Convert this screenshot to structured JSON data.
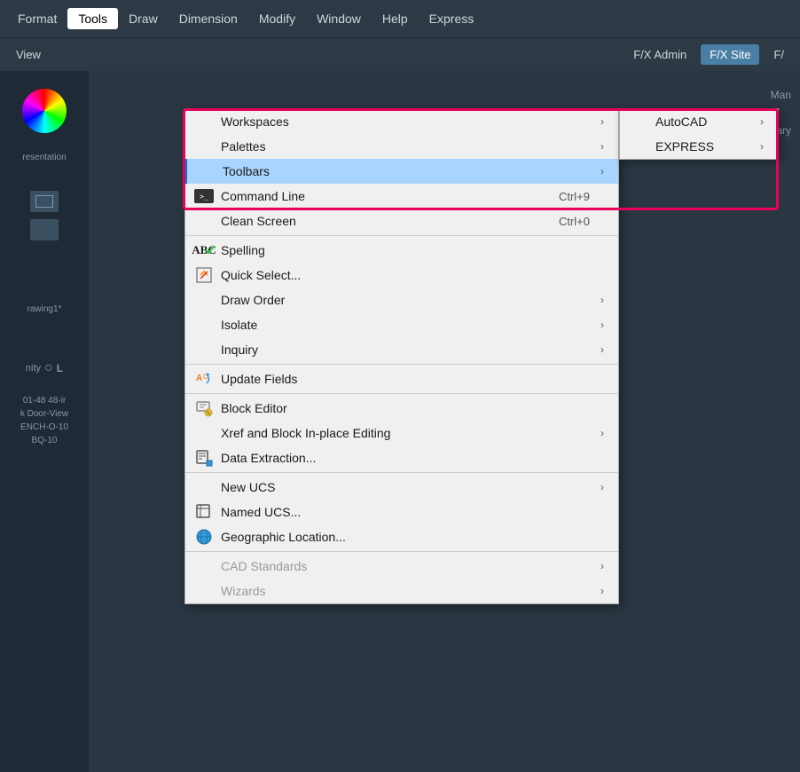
{
  "menubar": {
    "items": [
      {
        "label": "Format",
        "active": false
      },
      {
        "label": "Tools",
        "active": true
      },
      {
        "label": "Draw",
        "active": false
      },
      {
        "label": "Dimension",
        "active": false
      },
      {
        "label": "Modify",
        "active": false
      },
      {
        "label": "Window",
        "active": false
      },
      {
        "label": "Help",
        "active": false
      },
      {
        "label": "Express",
        "active": false
      }
    ]
  },
  "toolbar_tabs": [
    {
      "label": "View",
      "active": false
    },
    {
      "label": "F/X Admin",
      "active": false
    },
    {
      "label": "F/X Site",
      "active": true
    },
    {
      "label": "F/",
      "active": false
    }
  ],
  "tools_menu": {
    "items": [
      {
        "id": "workspaces",
        "label": "Workspaces",
        "shortcut": "",
        "hasArrow": true,
        "icon": ""
      },
      {
        "id": "palettes",
        "label": "Palettes",
        "shortcut": "",
        "hasArrow": true,
        "icon": ""
      },
      {
        "id": "toolbars",
        "label": "Toolbars",
        "shortcut": "",
        "hasArrow": true,
        "icon": "",
        "highlighted": true
      },
      {
        "id": "command-line",
        "label": "Command Line",
        "shortcut": "Ctrl+9",
        "hasArrow": false,
        "icon": "terminal"
      },
      {
        "id": "clean-screen",
        "label": "Clean Screen",
        "shortcut": "Ctrl+0",
        "hasArrow": false,
        "icon": ""
      },
      {
        "id": "spelling",
        "label": "Spelling",
        "shortcut": "",
        "hasArrow": false,
        "icon": "spelling"
      },
      {
        "id": "quick-select",
        "label": "Quick Select...",
        "shortcut": "",
        "hasArrow": false,
        "icon": "quickselect"
      },
      {
        "id": "draw-order",
        "label": "Draw Order",
        "shortcut": "",
        "hasArrow": true,
        "icon": ""
      },
      {
        "id": "isolate",
        "label": "Isolate",
        "shortcut": "",
        "hasArrow": true,
        "icon": ""
      },
      {
        "id": "inquiry",
        "label": "Inquiry",
        "shortcut": "",
        "hasArrow": true,
        "icon": ""
      },
      {
        "id": "update-fields",
        "label": "Update Fields",
        "shortcut": "",
        "hasArrow": false,
        "icon": "update-fields"
      },
      {
        "id": "block-editor",
        "label": "Block Editor",
        "shortcut": "",
        "hasArrow": false,
        "icon": "block-editor"
      },
      {
        "id": "xref-editing",
        "label": "Xref and Block In-place Editing",
        "shortcut": "",
        "hasArrow": true,
        "icon": ""
      },
      {
        "id": "data-extraction",
        "label": "Data Extraction...",
        "shortcut": "",
        "hasArrow": false,
        "icon": "data-extraction"
      },
      {
        "id": "new-ucs",
        "label": "New UCS",
        "shortcut": "",
        "hasArrow": true,
        "icon": ""
      },
      {
        "id": "named-ucs",
        "label": "Named UCS...",
        "shortcut": "",
        "hasArrow": false,
        "icon": "named-ucs"
      },
      {
        "id": "geographic-location",
        "label": "Geographic Location...",
        "shortcut": "",
        "hasArrow": false,
        "icon": "globe"
      },
      {
        "id": "cad-standards",
        "label": "CAD Standards",
        "shortcut": "",
        "hasArrow": true,
        "icon": "",
        "disabled": true
      },
      {
        "id": "wizards",
        "label": "Wizards",
        "shortcut": "",
        "hasArrow": true,
        "icon": "",
        "disabled": true
      }
    ]
  },
  "toolbars_submenu": {
    "items": [
      {
        "label": "AutoCAD",
        "hasArrow": true
      },
      {
        "label": "EXPRESS",
        "hasArrow": true
      }
    ]
  },
  "left_sidebar": {
    "drawing_label": "rawing1*",
    "bottom_labels": [
      "nity",
      "01-48 48-ir",
      "k Door-View",
      "ENCH-O-10",
      "BQ-10"
    ]
  },
  "right_sidebar": {
    "labels": [
      "Man",
      "Library"
    ]
  },
  "pink_box": {
    "description": "Highlights Toolbars submenu area"
  }
}
